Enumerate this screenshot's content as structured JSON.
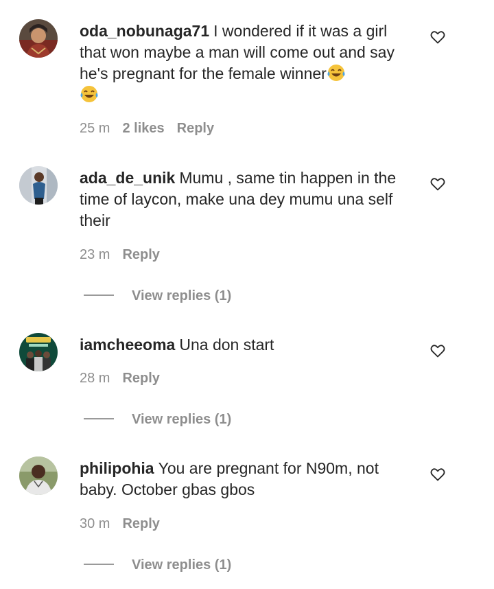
{
  "comments": [
    {
      "username": "oda_nobunaga71",
      "text": "I wondered if it was a girl that won maybe a man will come out and say he's pregnant for the female winner",
      "emoji_icon": "face-with-tears-of-joy-icon",
      "time": "25 m",
      "likes": "2 likes",
      "reply_label": "Reply",
      "view_replies": ""
    },
    {
      "username": "ada_de_unik",
      "text": "Mumu , same tin happen in the time of laycon, make una dey mumu una self their",
      "time": "23 m",
      "likes": "",
      "reply_label": "Reply",
      "view_replies": "View replies (1)"
    },
    {
      "username": "iamcheeoma",
      "text": "Una don start",
      "time": "28 m",
      "likes": "",
      "reply_label": "Reply",
      "view_replies": "View replies (1)"
    },
    {
      "username": "philipohia",
      "text": "You are pregnant for N90m, not baby. October gbas gbos",
      "time": "30 m",
      "likes": "",
      "reply_label": "Reply",
      "view_replies": "View replies (1)"
    }
  ],
  "icons": {
    "like": "heart-outline-icon",
    "reply_divider": "reply-thread-line"
  },
  "colors": {
    "text": "#262626",
    "secondary": "#8e8e8e",
    "background": "#ffffff"
  }
}
